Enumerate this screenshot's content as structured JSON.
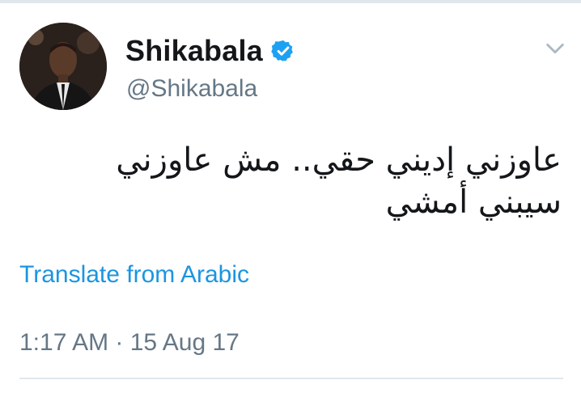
{
  "tweet": {
    "author_name": "Shikabala",
    "handle": "@Shikabala",
    "verified_icon": "verified-badge-icon",
    "menu_icon": "chevron-down-icon",
    "text": "عاوزني إديني حقي.. مش عاوزني سيبني أمشي",
    "translate_link": "Translate from Arabic",
    "timestamp": "1:17 AM · 15 Aug 17"
  },
  "colors": {
    "link": "#1b95e0",
    "verified": "#1da1f2",
    "secondary_text": "#657786",
    "divider": "#e1e8ed"
  }
}
